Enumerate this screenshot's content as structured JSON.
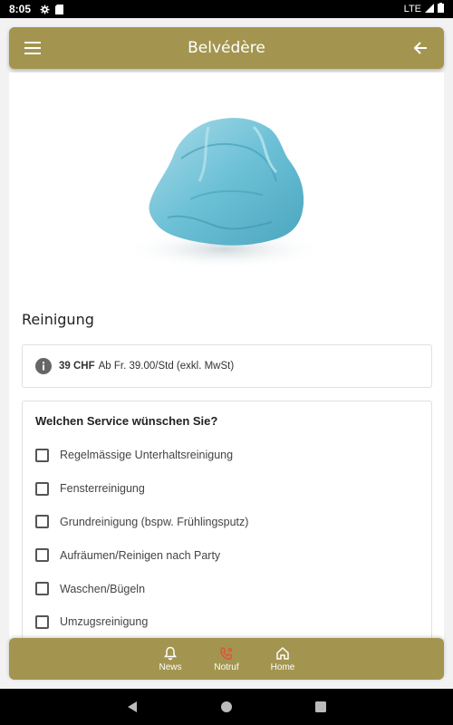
{
  "status_bar": {
    "time": "8:05",
    "network": "LTE"
  },
  "header": {
    "title": "Belvédère"
  },
  "hero": {
    "image": "cleaning-cloth"
  },
  "service": {
    "title": "Reinigung"
  },
  "price": {
    "amount": "39 CHF",
    "detail": "Ab Fr. 39.00/Std (exkl. MwSt)"
  },
  "question": "Welchen Service wünschen Sie?",
  "options": [
    {
      "label": "Regelmässige Unterhaltsreinigung",
      "checked": false
    },
    {
      "label": "Fensterreinigung",
      "checked": false
    },
    {
      "label": "Grundreinigung (bspw. Frühlingsputz)",
      "checked": false
    },
    {
      "label": "Aufräumen/Reinigen nach Party",
      "checked": false
    },
    {
      "label": "Waschen/Bügeln",
      "checked": false
    },
    {
      "label": "Umzugsreinigung",
      "checked": false
    }
  ],
  "bottom_nav": [
    {
      "label": "News",
      "icon": "bell-icon"
    },
    {
      "label": "Notruf",
      "icon": "phone-call-icon"
    },
    {
      "label": "Home",
      "icon": "home-icon"
    }
  ],
  "colors": {
    "brand": "#a39550",
    "notruf_icon": "#e0533c"
  }
}
